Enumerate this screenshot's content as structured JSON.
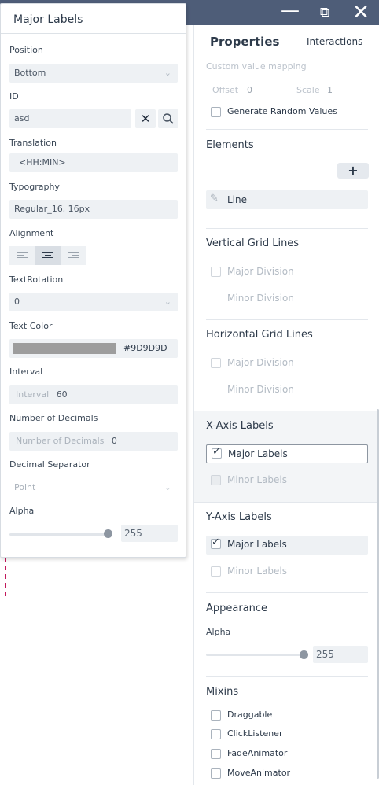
{
  "window_controls": {
    "minimize": "—",
    "maximize": "⧉",
    "close": "✕"
  },
  "tabs": {
    "properties": "Properties",
    "interactions": "Interactions"
  },
  "props": {
    "custom_value_mapping": "Custom value mapping",
    "offset_label": "Offset",
    "offset_value": "0",
    "scale_label": "Scale",
    "scale_value": "1",
    "generate_random": "Generate Random Values",
    "elements_title": "Elements",
    "add_button": "+",
    "line_item": "Line",
    "vertical_grid_title": "Vertical Grid Lines",
    "horizontal_grid_title": "Horizontal Grid Lines",
    "major_division": "Major Division",
    "minor_division": "Minor Division",
    "x_axis_title": "X-Axis Labels",
    "y_axis_title": "Y-Axis Labels",
    "major_labels": "Major Labels",
    "minor_labels": "Minor Labels",
    "appearance_title": "Appearance",
    "alpha_label": "Alpha",
    "alpha_value": "255",
    "alpha_fraction": 1.0,
    "mixins_title": "Mixins",
    "mixins": [
      "Draggable",
      "ClickListener",
      "FadeAnimator",
      "MoveAnimator"
    ]
  },
  "popup": {
    "title": "Major Labels",
    "position_label": "Position",
    "position_value": "Bottom",
    "id_label": "ID",
    "id_value": "asd",
    "translation_label": "Translation",
    "translation_value": "<HH:MIN>",
    "typography_label": "Typography",
    "typography_value": "Regular_16, 16px",
    "alignment_label": "Alignment",
    "text_rotation_label": "TextRotation",
    "text_rotation_value": "0",
    "text_color_label": "Text Color",
    "text_color_value": "#9D9D9D",
    "interval_label": "Interval",
    "interval_placeholder": "Interval",
    "interval_value": "60",
    "decimals_label": "Number of Decimals",
    "decimals_placeholder": "Number of Decimals",
    "decimals_value": "0",
    "decimal_separator_label": "Decimal Separator",
    "decimal_separator_value": "Point",
    "alpha_label": "Alpha",
    "alpha_value": "255",
    "alpha_fraction": 1.0
  },
  "colors": {
    "text_color_swatch": "#9D9D9D",
    "topbar": "#4e5d78",
    "dashed_marker": "#c2185b"
  },
  "icons": {
    "clear": "close-icon",
    "search": "search-icon",
    "chevron": "chevron-down-icon",
    "pencil": "pencil-icon"
  }
}
